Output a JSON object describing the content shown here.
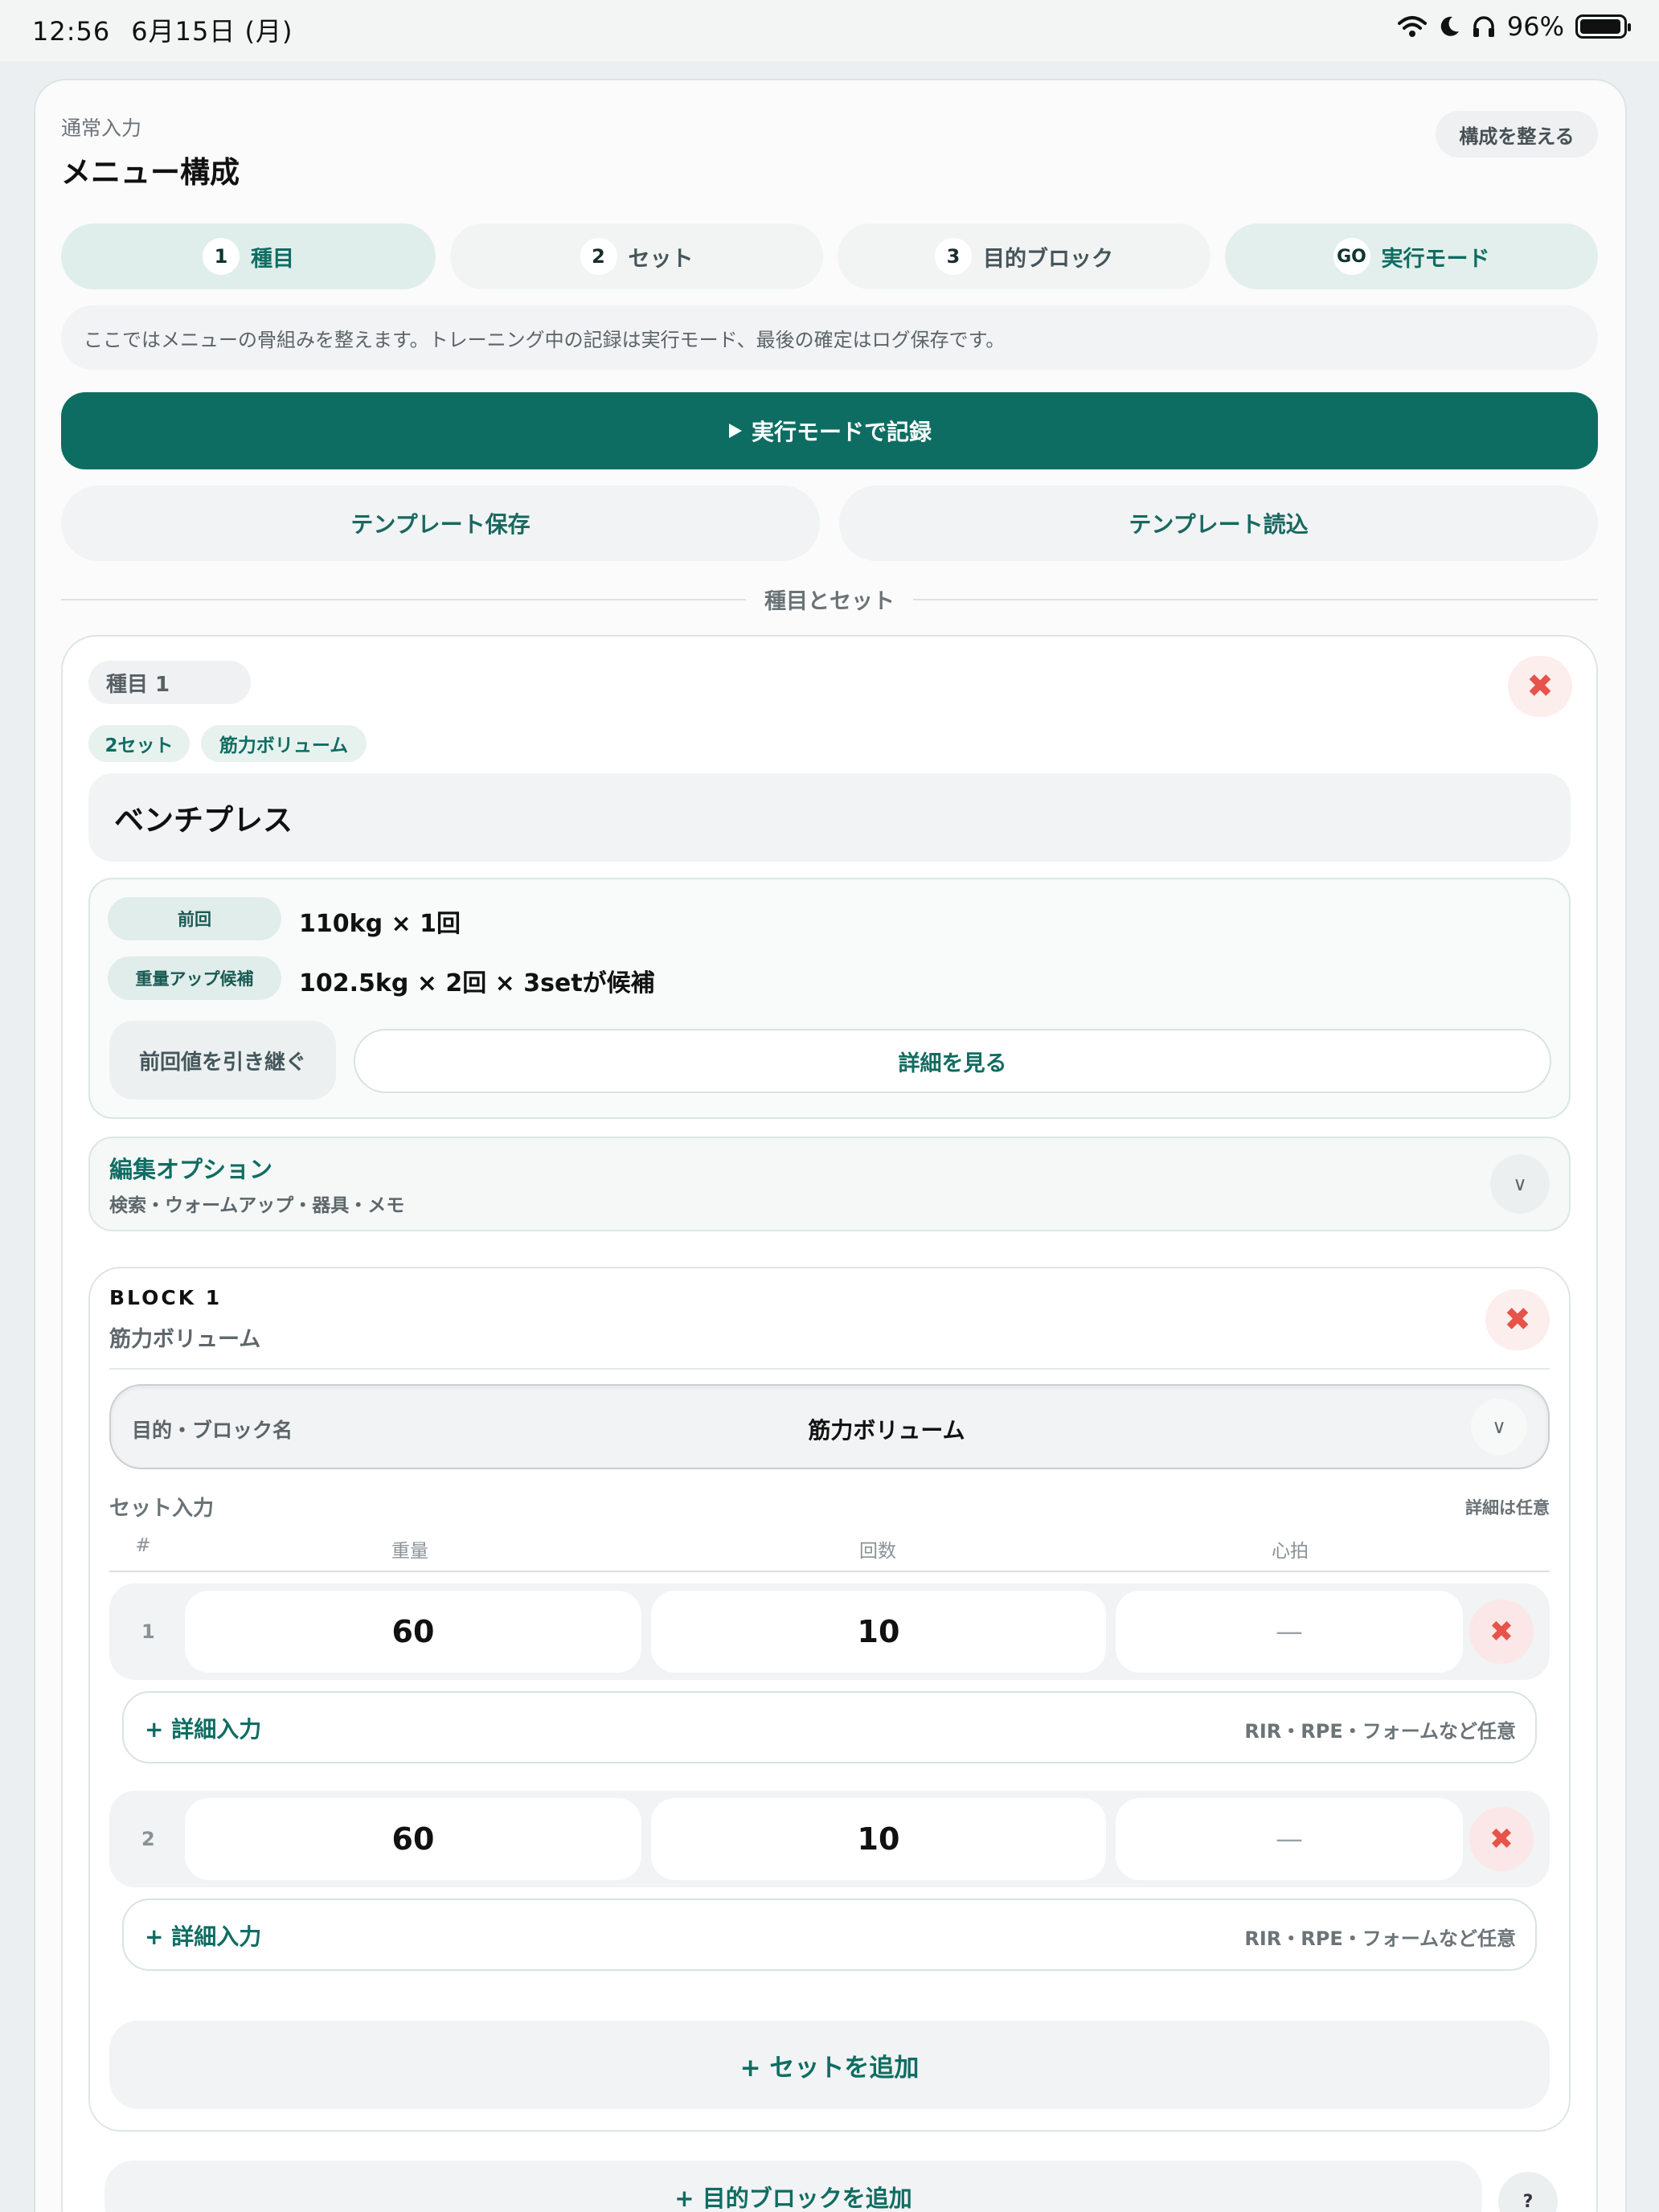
{
  "status_bar": {
    "time": "12:56",
    "date": "6月15日 (月)",
    "battery": "96%",
    "battery_level": 0.96
  },
  "header": {
    "eyebrow": "通常入力",
    "title": "メニュー構成",
    "tidy_button": "構成を整える"
  },
  "tabs": [
    {
      "num": "1",
      "label": "種目",
      "active": true
    },
    {
      "num": "2",
      "label": "セット",
      "active": false
    },
    {
      "num": "3",
      "label": "目的ブロック",
      "active": false
    },
    {
      "num": "GO",
      "label": "実行モード",
      "active": false
    }
  ],
  "info_text": "ここではメニューの骨組みを整えます。トレーニング中の記録は実行モード、最後の確定はログ保存です。",
  "actions": {
    "run_mode": "実行モードで記録",
    "save_template": "テンプレート保存",
    "load_template": "テンプレート読込"
  },
  "section_divider": "種目とセット",
  "exercise": {
    "chip": "種目 1",
    "tags": [
      "2セット",
      "筋力ボリューム"
    ],
    "name": "ベンチプレス",
    "history": {
      "prev_label": "前回",
      "prev_value": "110kg × 1回",
      "suggest_label": "重量アップ候補",
      "suggest_value": "102.5kg × 2回 × 3setが候補",
      "inherit_button": "前回値を引き継ぐ",
      "detail_button": "詳細を見る"
    },
    "options": {
      "title": "編集オプション",
      "subtitle": "検索・ウォームアップ・器具・メモ"
    },
    "block": {
      "title": "BLOCK 1",
      "subtitle": "筋力ボリューム",
      "purpose_label": "目的・ブロック名",
      "purpose_value": "筋力ボリューム",
      "sets_heading": "セット入力",
      "sets_note": "詳細は任意",
      "columns": [
        "#",
        "重量",
        "回数",
        "心拍"
      ],
      "sets": [
        {
          "index": "1",
          "weight": "60",
          "reps": "10",
          "hr": "—"
        },
        {
          "index": "2",
          "weight": "60",
          "reps": "10",
          "hr": "—"
        }
      ],
      "detail_label": "+ 詳細入力",
      "detail_hint": "RIR・RPE・フォームなど任意",
      "add_set": "+ セットを追加"
    }
  },
  "add_block": "+ 目的ブロックを追加",
  "help": "?",
  "colors": {
    "accent": "#0e6d63",
    "accent_light": "#dfeeeb",
    "danger": "#e5534b"
  }
}
